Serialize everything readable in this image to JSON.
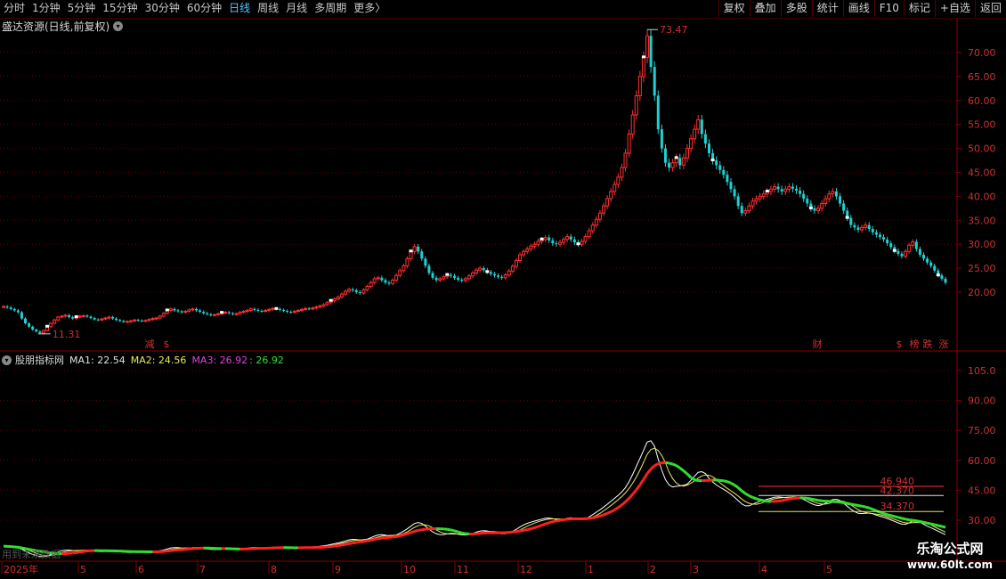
{
  "toolbar": {
    "periods": [
      "分时",
      "1分钟",
      "5分钟",
      "15分钟",
      "30分钟",
      "60分钟",
      "日线",
      "周线",
      "月线",
      "多周期",
      "更多"
    ],
    "active_period": "日线",
    "more_arrow": "〉",
    "buttons": [
      "复权",
      "叠加",
      "多股",
      "统计",
      "画线",
      "F10",
      "标记",
      "+自选",
      "返回"
    ]
  },
  "main_panel": {
    "title": "盛达资源(日线,前复权)",
    "high_label": "73.47",
    "low_label": "11.31",
    "y_ticks": [
      "70.00",
      "65.00",
      "60.00",
      "55.00",
      "50.00",
      "45.00",
      "40.00",
      "35.00",
      "30.00",
      "25.00",
      "20.00"
    ],
    "markers": [
      {
        "text": "减",
        "color": "#30d030"
      },
      {
        "text": "$",
        "color": "#ff3030"
      },
      {
        "text": "财",
        "color": "#3090ff"
      },
      {
        "text": "$",
        "color": "#ff3030"
      },
      {
        "text": "榜",
        "color": "#e0c020"
      },
      {
        "text": "跌",
        "color": "#30d030"
      },
      {
        "text": "涨",
        "color": "#ff3030"
      }
    ]
  },
  "indicator_panel": {
    "name": "股朋指标网",
    "ma1": "MA1: 22.54",
    "ma2": "MA2: 24.56",
    "ma3": "MA3: 26.92",
    "ma3_extra": ": 26.92",
    "y_ticks": [
      "105.0",
      "90.00",
      "75.00",
      "60.00",
      "45.00",
      "30.00"
    ],
    "levels": [
      {
        "label": "46.940",
        "color": "#ff3030"
      },
      {
        "label": "42.370",
        "color": "#e0e0e0"
      },
      {
        "label": "34.370",
        "color": "#e0e060"
      }
    ],
    "colors": {
      "ma_red": "#ff2020",
      "ma_green": "#30e030",
      "ma_white": "#ffffff",
      "ma_yellow": "#e8e860"
    }
  },
  "date_axis": [
    "2025年",
    "5",
    "6",
    "7",
    "8",
    "9",
    "10",
    "11",
    "12",
    "1",
    "2",
    "3",
    "4",
    "5"
  ],
  "bottom_note": "用到未来数据",
  "watermark": {
    "line1": "乐淘公式网",
    "line2": "www.60lt.com"
  },
  "chart_data": {
    "type": "candlestick",
    "price_range": [
      11.31,
      73.47
    ],
    "closes": [
      17,
      16.8,
      16.5,
      16.2,
      15.8,
      14.5,
      13.5,
      12.8,
      12.2,
      11.8,
      11.5,
      12,
      12.8,
      13.5,
      14.2,
      14.8,
      15,
      15.2,
      14.8,
      14.5,
      14.8,
      15,
      15.1,
      14.9,
      14.6,
      14.3,
      14.2,
      14.4,
      14.6,
      14.8,
      14.5,
      14.2,
      14,
      13.8,
      13.9,
      14,
      14.2,
      14.1,
      14,
      14.1,
      14.3,
      14.5,
      14.6,
      15,
      15.6,
      16.2,
      16.5,
      16.2,
      16,
      15.8,
      16,
      16.3,
      16.5,
      16.2,
      15.9,
      15.6,
      15.4,
      15.2,
      15.3,
      15.5,
      15.7,
      15.8,
      15.6,
      15.4,
      15.5,
      15.8,
      16,
      16.2,
      16.5,
      16.3,
      16.1,
      16,
      16.2,
      16.4,
      16.6,
      16.5,
      16.3,
      16.1,
      15.9,
      15.8,
      16,
      16.2,
      16.4,
      16.6,
      16.5,
      16.7,
      16.9,
      17.1,
      17.4,
      17.8,
      18.2,
      18.6,
      19,
      19.6,
      20.2,
      20.6,
      20.4,
      20,
      19.8,
      20.5,
      21.2,
      22,
      22.8,
      23,
      22.5,
      22,
      21.8,
      22.5,
      23.5,
      24.5,
      25.5,
      27,
      28.5,
      29.5,
      28.5,
      27,
      25.5,
      24,
      23,
      22.5,
      22.8,
      23.2,
      23.6,
      23.4,
      23,
      22.6,
      22.4,
      22.8,
      23.4,
      24,
      24.6,
      25,
      24.6,
      24.2,
      23.8,
      23.5,
      23.2,
      23,
      23.6,
      24.4,
      25.4,
      26.6,
      27.8,
      28.5,
      29,
      29.6,
      30,
      30.6,
      31,
      31.4,
      30.8,
      30.2,
      30,
      30.4,
      31,
      31.6,
      31,
      30.4,
      30,
      30.6,
      31.6,
      32.8,
      34,
      35.2,
      36.5,
      38,
      39.5,
      41,
      42.5,
      44,
      46,
      49,
      53,
      57,
      61,
      65,
      69,
      73.47,
      67,
      61,
      54,
      50,
      47,
      46,
      47,
      48,
      46.5,
      48,
      50,
      52,
      54,
      56,
      53,
      51,
      49,
      47.5,
      46.5,
      45.5,
      44.5,
      43,
      41.5,
      40,
      38,
      36.5,
      37,
      38,
      39,
      39.5,
      40,
      40.5,
      41,
      41.5,
      42,
      41.5,
      41,
      41.5,
      42,
      41.6,
      41.2,
      40.5,
      39.5,
      38.5,
      37.5,
      37,
      37.5,
      38.5,
      39.5,
      40.5,
      41,
      40,
      38.5,
      37,
      35.5,
      34,
      33.5,
      33,
      33.5,
      34,
      33.2,
      32.5,
      32,
      31.5,
      31,
      30.2,
      29.4,
      28.6,
      28,
      27.5,
      28.5,
      29.8,
      30.5,
      29,
      27.8,
      27,
      26.2,
      25.5,
      24.5,
      23.5,
      22.8,
      22
    ]
  }
}
